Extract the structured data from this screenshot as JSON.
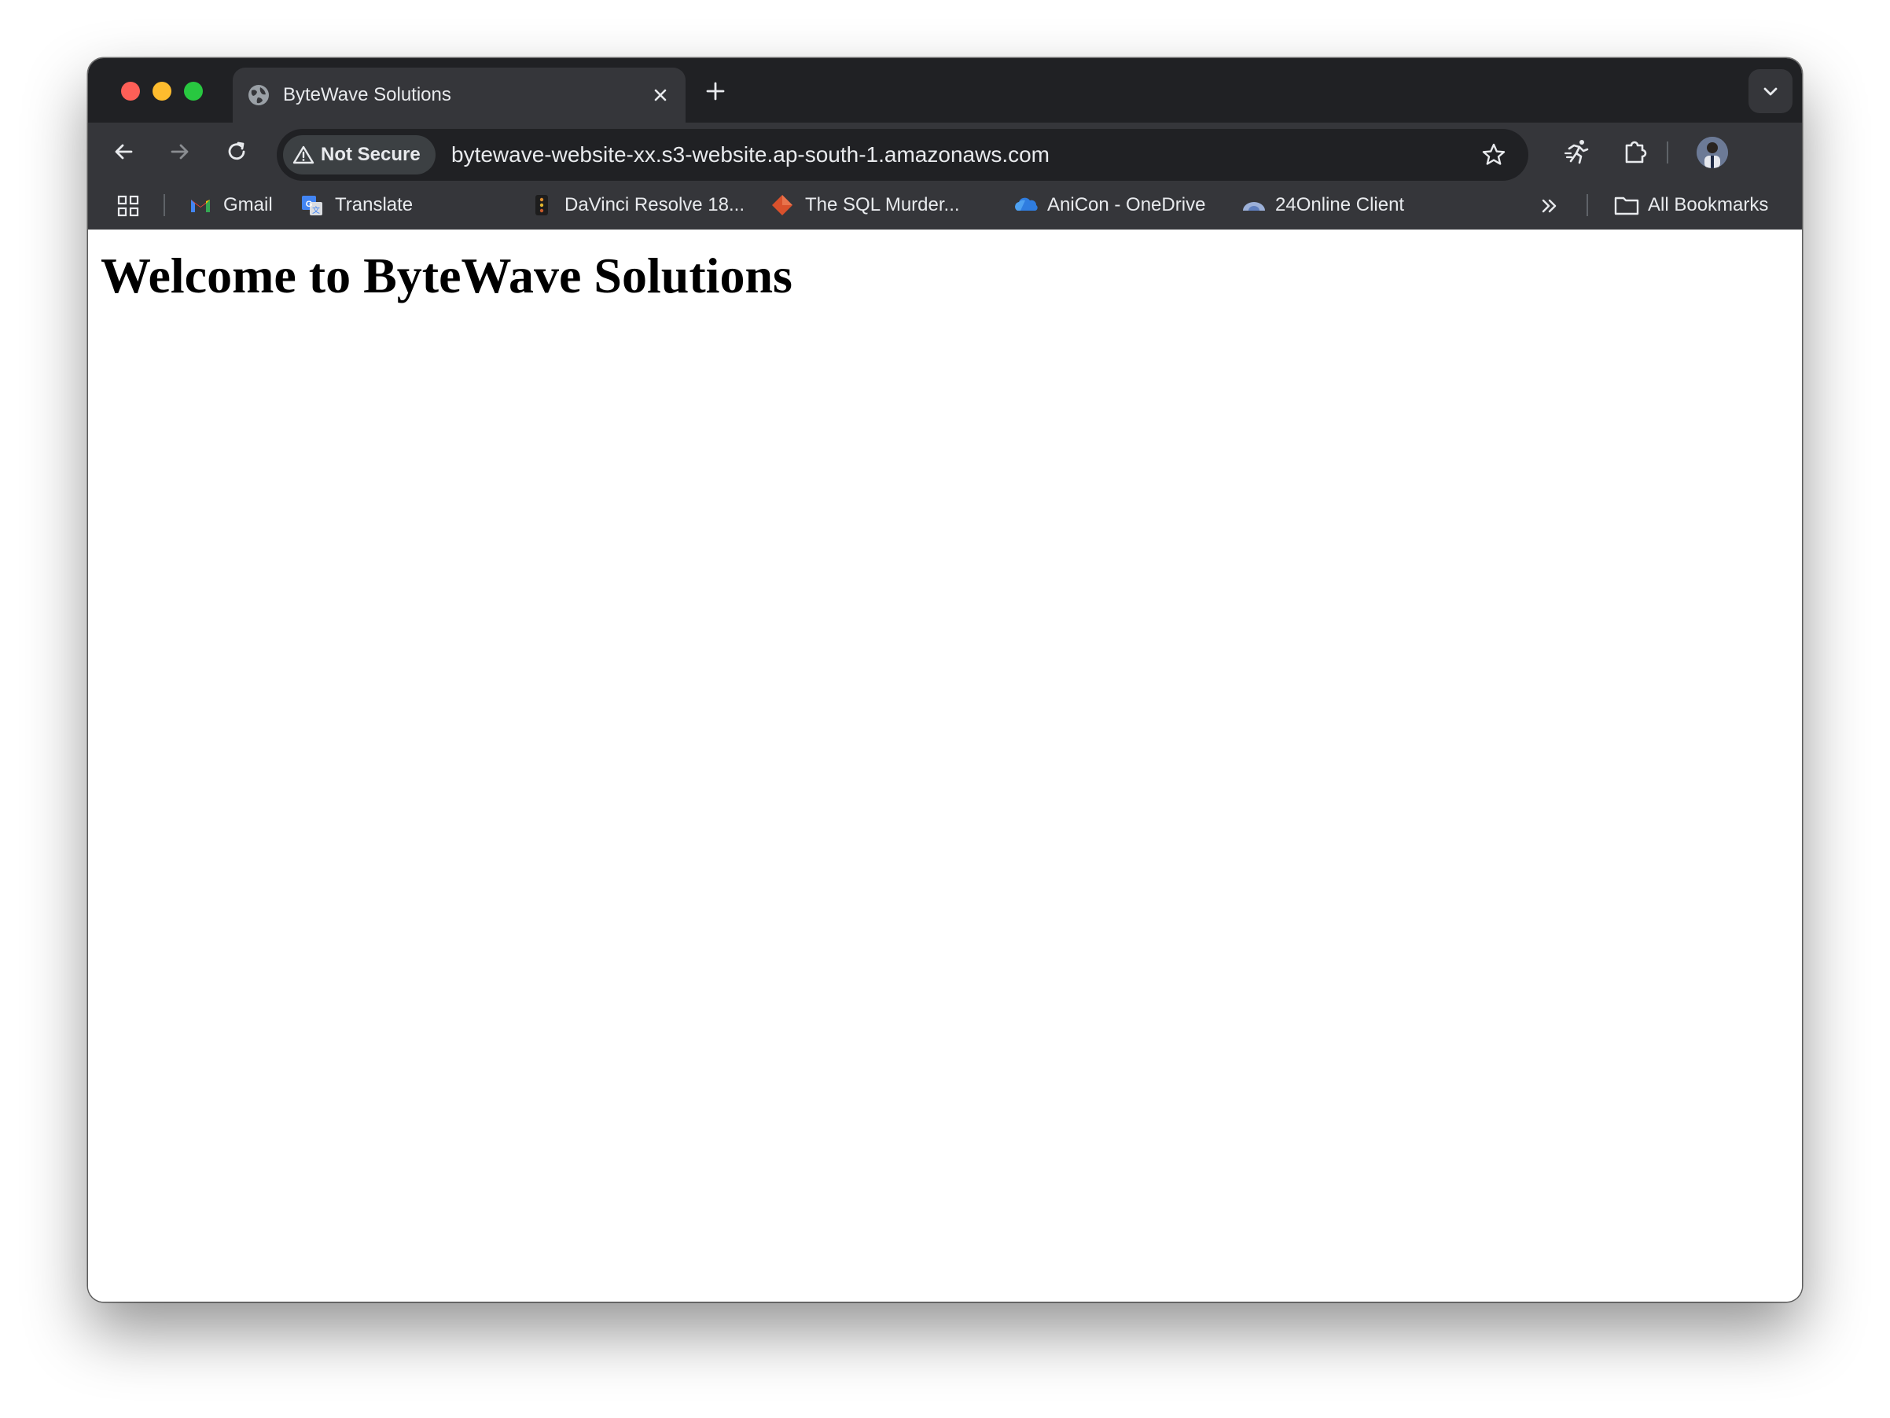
{
  "browser": {
    "tab": {
      "title": "ByteWave Solutions"
    },
    "address_bar": {
      "security_chip": "Not Secure",
      "url": "bytewave-website-xx.s3-website.ap-south-1.amazonaws.com"
    },
    "bookmarks": [
      {
        "label": "Gmail",
        "icon": "gmail-icon"
      },
      {
        "label": "Translate",
        "icon": "translate-icon"
      },
      {
        "label": "DaVinci Resolve 18...",
        "icon": "davinci-icon"
      },
      {
        "label": "The SQL Murder...",
        "icon": "diamond-icon"
      },
      {
        "label": "AniCon - OneDrive",
        "icon": "onedrive-icon"
      },
      {
        "label": "24Online Client",
        "icon": "cloud-icon"
      }
    ],
    "all_bookmarks": "All Bookmarks"
  },
  "page": {
    "heading": "Welcome to ByteWave Solutions"
  },
  "colors": {
    "tab_strip": "#202124",
    "toolbar": "#35363a",
    "omnibox": "#202124",
    "text": "#e8eaed",
    "close_light": "#fe5f57",
    "minimize_light": "#febc2e",
    "maximize_light": "#28c840"
  }
}
